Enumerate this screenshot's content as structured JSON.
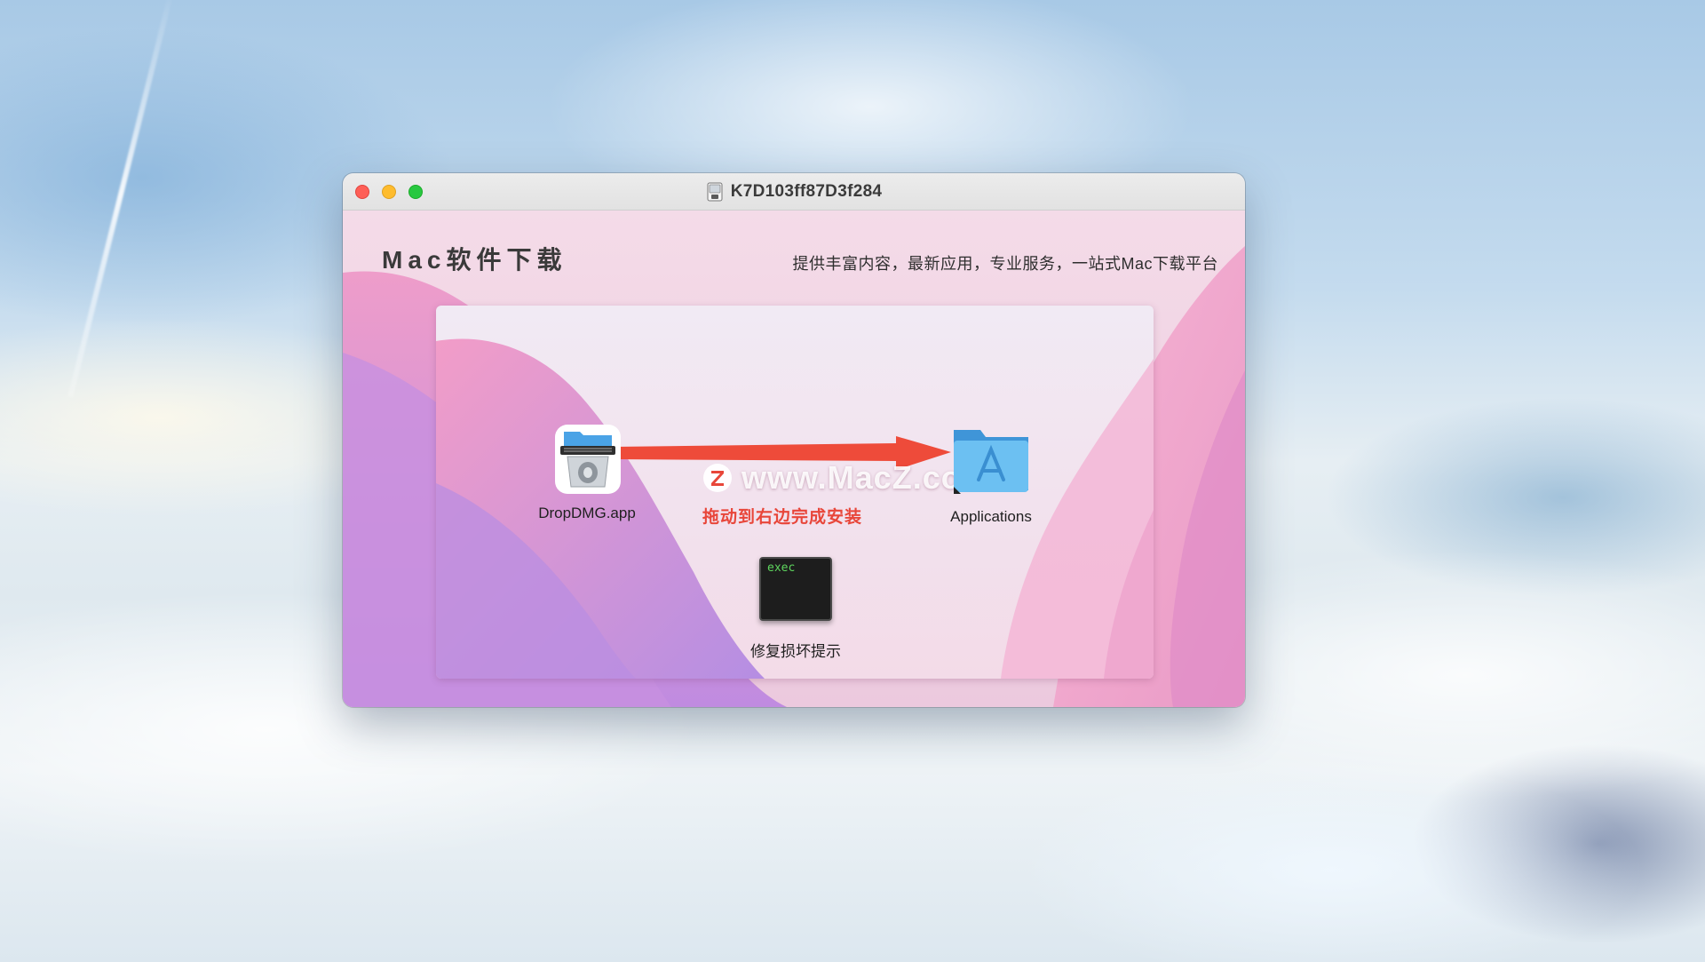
{
  "window": {
    "title": "K7D103ff87D3f284"
  },
  "header": {
    "brand": "Mac软件下载",
    "slogan": "提供丰富内容，最新应用，专业服务，一站式Mac下载平台"
  },
  "installer": {
    "app_label": "DropDMG.app",
    "app_icon": "dropdmg-app-icon",
    "applications_label": "Applications",
    "applications_icon": "applications-folder-icon",
    "hint": "拖动到右边完成安装",
    "watermark": "www.MacZ.com",
    "exec_icon_text": "exec",
    "exec_label": "修复损坏提示"
  },
  "colors": {
    "arrow": "#ee4b3a",
    "hint": "#e8463a",
    "close": "#fe5f57",
    "minimize": "#febc2e",
    "maximize": "#28c840"
  }
}
